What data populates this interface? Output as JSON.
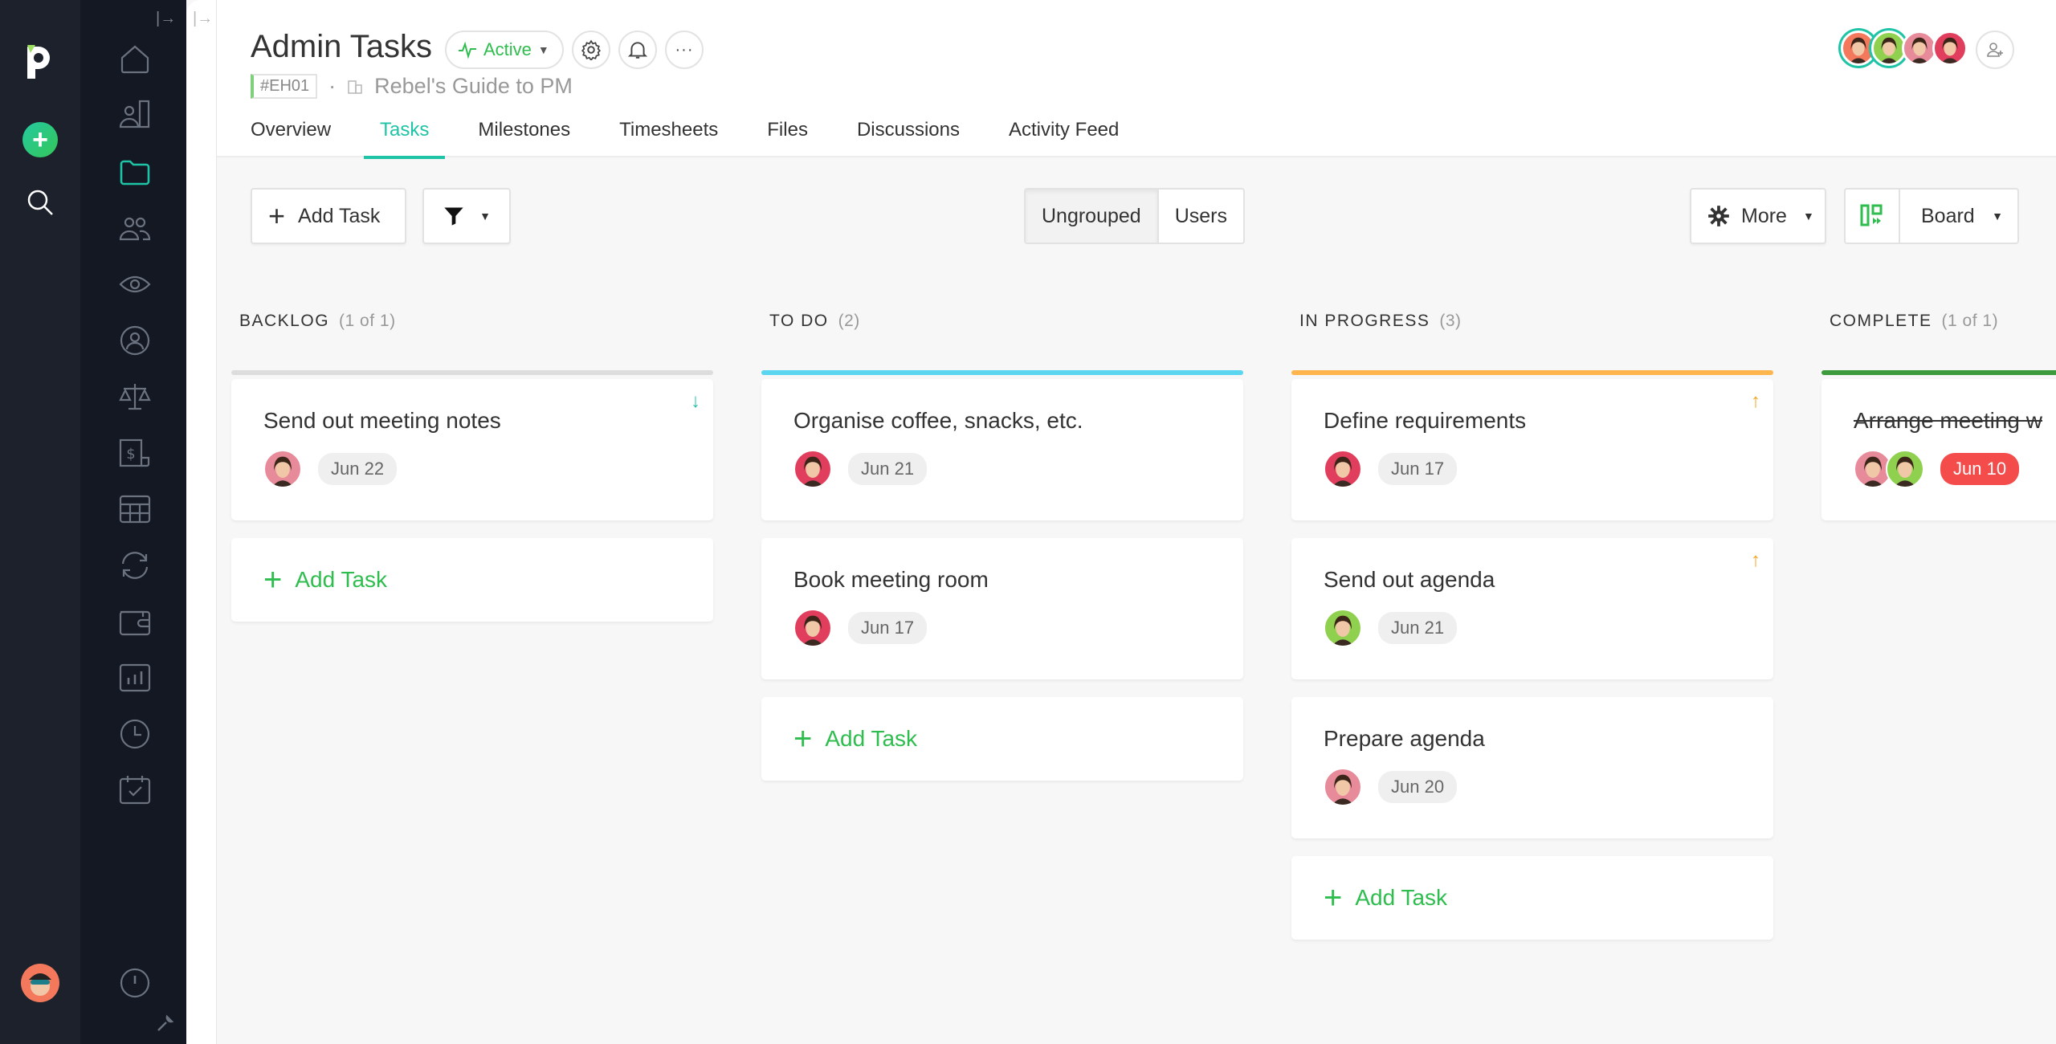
{
  "rail": {
    "logo": "paymo-logo",
    "add_label": "+",
    "search_icon": "search-icon",
    "profile_avatar": "user-avatar"
  },
  "nav": {
    "collapse_glyph": "|→",
    "items": [
      {
        "name": "home",
        "icon": "home-icon",
        "active": false
      },
      {
        "name": "clients",
        "icon": "clients-icon",
        "active": false
      },
      {
        "name": "projects",
        "icon": "folder-icon",
        "active": true
      },
      {
        "name": "team",
        "icon": "team-icon",
        "active": false
      },
      {
        "name": "watch",
        "icon": "eye-icon",
        "active": false
      },
      {
        "name": "account",
        "icon": "user-circle-icon",
        "active": false
      },
      {
        "name": "balance",
        "icon": "scale-icon",
        "active": false
      },
      {
        "name": "invoices",
        "icon": "invoice-icon",
        "active": false
      },
      {
        "name": "table",
        "icon": "table-icon",
        "active": false
      },
      {
        "name": "recurring",
        "icon": "refresh-icon",
        "active": false
      },
      {
        "name": "expenses",
        "icon": "wallet-icon",
        "active": false
      },
      {
        "name": "reports",
        "icon": "chart-icon",
        "active": false
      },
      {
        "name": "time",
        "icon": "clock-icon",
        "active": false
      },
      {
        "name": "calendar",
        "icon": "calendar-check-icon",
        "active": false
      }
    ],
    "bottom_icon": "info-icon",
    "wrench_icon": "wrench-icon"
  },
  "header": {
    "collapse_glyph": "|→",
    "title": "Admin Tasks",
    "status": "Active",
    "code": "#EH01",
    "separator": "·",
    "client": "Rebel's Guide to PM",
    "tabs": [
      {
        "label": "Overview",
        "active": false
      },
      {
        "label": "Tasks",
        "active": true
      },
      {
        "label": "Milestones",
        "active": false
      },
      {
        "label": "Timesheets",
        "active": false
      },
      {
        "label": "Files",
        "active": false
      },
      {
        "label": "Discussions",
        "active": false
      },
      {
        "label": "Activity Feed",
        "active": false
      }
    ],
    "members": [
      {
        "color": "#f4795c",
        "ring": true
      },
      {
        "color": "#8fd14f",
        "ring": true
      },
      {
        "color": "#e78a9a",
        "ring": false
      },
      {
        "color": "#e03e5c",
        "ring": false
      }
    ]
  },
  "toolbar": {
    "add_task": "Add Task",
    "grouping": [
      {
        "label": "Ungrouped",
        "active": true
      },
      {
        "label": "Users",
        "active": false
      }
    ],
    "more": "More",
    "view": "Board"
  },
  "colors": {
    "accent": "#1fc4a6",
    "green": "#2ebd4e",
    "backlog": "#dddddd",
    "todo": "#5bd5f0",
    "in_progress": "#ffb54d",
    "complete": "#3d9b3d",
    "overdue": "#f44b4b",
    "priority_low": "#1fc4a6",
    "priority_high": "#f5a623"
  },
  "board": {
    "add_task_label": "Add Task",
    "columns": [
      {
        "title": "BACKLOG",
        "count": "(1 of 1)",
        "tasks": [
          {
            "title": "Send out meeting notes",
            "date": "Jun 22",
            "priority": "low",
            "faces": [
              "#e78a9a"
            ],
            "done": false,
            "overdue": false
          }
        ]
      },
      {
        "title": "TO DO",
        "count": "(2)",
        "tasks": [
          {
            "title": "Organise coffee, snacks, etc.",
            "date": "Jun 21",
            "priority": "",
            "faces": [
              "#e03e5c"
            ],
            "done": false,
            "overdue": false
          },
          {
            "title": "Book meeting room",
            "date": "Jun 17",
            "priority": "",
            "faces": [
              "#e03e5c"
            ],
            "done": false,
            "overdue": false
          }
        ]
      },
      {
        "title": "IN PROGRESS",
        "count": "(3)",
        "tasks": [
          {
            "title": "Define requirements",
            "date": "Jun 17",
            "priority": "high",
            "faces": [
              "#e03e5c"
            ],
            "done": false,
            "overdue": false
          },
          {
            "title": "Send out agenda",
            "date": "Jun 21",
            "priority": "high",
            "faces": [
              "#8fd14f"
            ],
            "done": false,
            "overdue": false
          },
          {
            "title": "Prepare agenda",
            "date": "Jun 20",
            "priority": "",
            "faces": [
              "#e78a9a"
            ],
            "done": false,
            "overdue": false
          }
        ]
      },
      {
        "title": "COMPLETE",
        "count": "(1 of 1)",
        "tasks": [
          {
            "title": "Arrange meeting w",
            "date": "Jun 10",
            "priority": "",
            "faces": [
              "#e78a9a",
              "#8fd14f"
            ],
            "done": true,
            "overdue": true
          }
        ]
      }
    ]
  }
}
